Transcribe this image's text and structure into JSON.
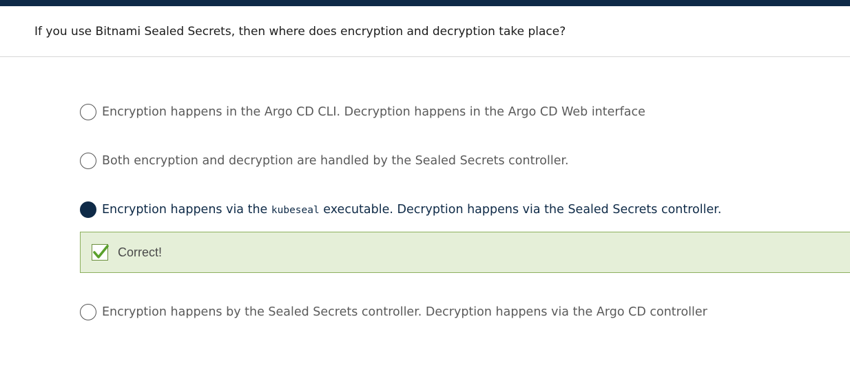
{
  "question": {
    "text": "If you use Bitnami Sealed Secrets, then where does encryption and decryption take place?"
  },
  "options": [
    {
      "label": "Encryption happens in the Argo CD CLI. Decryption happens in the Argo CD Web interface",
      "selected": false
    },
    {
      "label": "Both encryption and decryption are handled by the Sealed Secrets controller.",
      "selected": false
    },
    {
      "label_before": "Encryption happens via the ",
      "label_code": "kubeseal",
      "label_after": " executable. Decryption happens via the Sealed Secrets controller.",
      "selected": true
    },
    {
      "label": "Encryption happens by the Sealed Secrets controller. Decryption happens via the Argo CD controller",
      "selected": false
    }
  ],
  "feedback": {
    "text": "Correct!",
    "icon": "checkmark-icon",
    "status": "correct"
  },
  "colors": {
    "top_bar": "#0e2a47",
    "selected_radio": "#0e2a47",
    "feedback_bg": "#e5efd8",
    "feedback_border": "#8cb05e",
    "check_color": "#5aa02c"
  }
}
